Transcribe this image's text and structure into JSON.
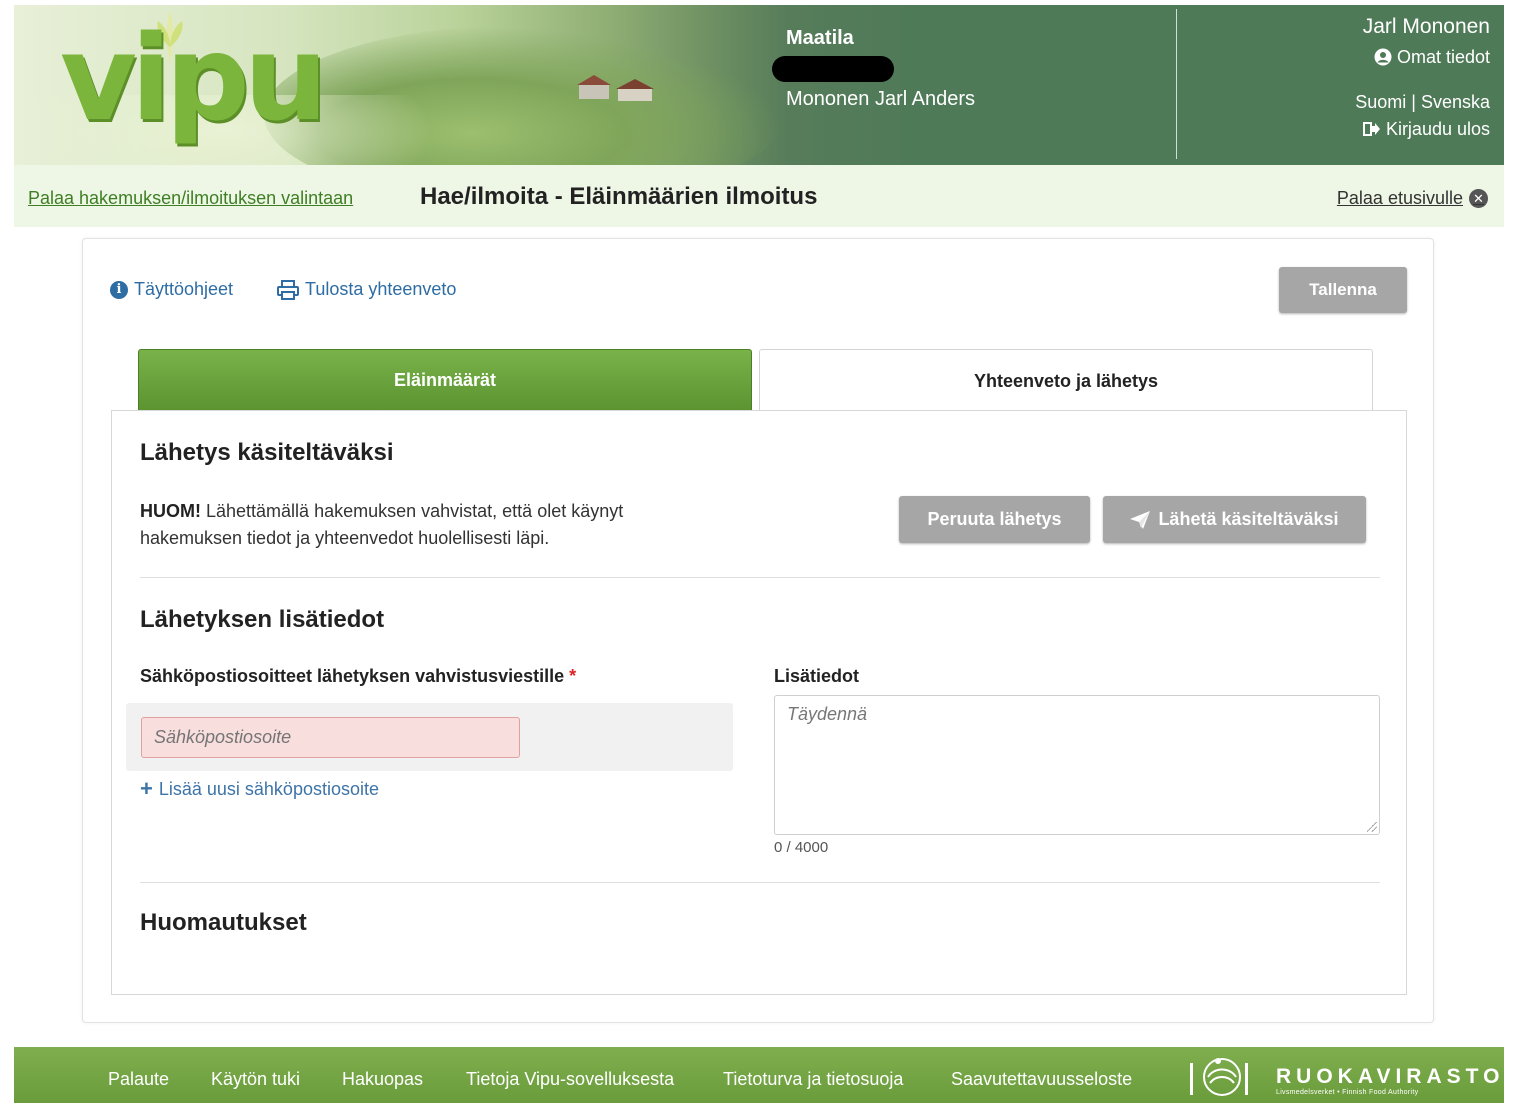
{
  "header": {
    "logo_text": "vipu",
    "farm_title": "Maatila",
    "farm_owner": "Mononen Jarl Anders",
    "user_name": "Jarl Mononen",
    "profile_link": "Omat tiedot",
    "lang_fi": "Suomi",
    "lang_sep": "|",
    "lang_sv": "Svenska",
    "logout": "Kirjaudu ulos"
  },
  "subbar": {
    "back_link": "Palaa hakemuksen/ilmoituksen valintaan",
    "title": "Hae/ilmoita - Eläinmäärien ilmoitus",
    "home_link": "Palaa etusivulle"
  },
  "toolbar": {
    "instructions": "Täyttöohjeet",
    "print": "Tulosta yhteenveto",
    "save": "Tallenna"
  },
  "tabs": [
    {
      "label": "Eläinmäärät",
      "active": true
    },
    {
      "label": "Yhteenveto ja lähetys",
      "active": false
    }
  ],
  "submit_section": {
    "title": "Lähetys käsiteltäväksi",
    "notice_bold": "HUOM!",
    "notice_text": " Lähettämällä hakemuksen vahvistat, että olet käynyt hakemuksen tiedot ja yhteenvedot huolellisesti läpi.",
    "cancel_button": "Peruuta lähetys",
    "send_button": "Lähetä käsiteltäväksi"
  },
  "details_section": {
    "title": "Lähetyksen lisätiedot",
    "email_label": "Sähköpostiosoitteet lähetyksen vahvistusviestille",
    "required_mark": "*",
    "email_placeholder": "Sähköpostiosoite",
    "add_email": "Lisää uusi sähköpostiosoite",
    "info_label": "Lisätiedot",
    "info_placeholder": "Täydennä",
    "char_counter": "0 / 4000"
  },
  "notes_section": {
    "title": "Huomautukset"
  },
  "footer": {
    "links": [
      "Palaute",
      "Käytön tuki",
      "Hakuopas",
      "Tietoja Vipu-sovelluksesta",
      "Tietoturva ja tietosuoja",
      "Saavutettavuusseloste"
    ],
    "brand": "RUOKAVIRASTO",
    "brand_sub": "Livsmedelsverket • Finnish Food Authority"
  },
  "colors": {
    "brand_green": "#7cb53c",
    "header_green": "#4f7a58",
    "link_blue": "#2e6ca4",
    "button_grey": "#a6a6a6",
    "error_bg": "#f9dede"
  }
}
